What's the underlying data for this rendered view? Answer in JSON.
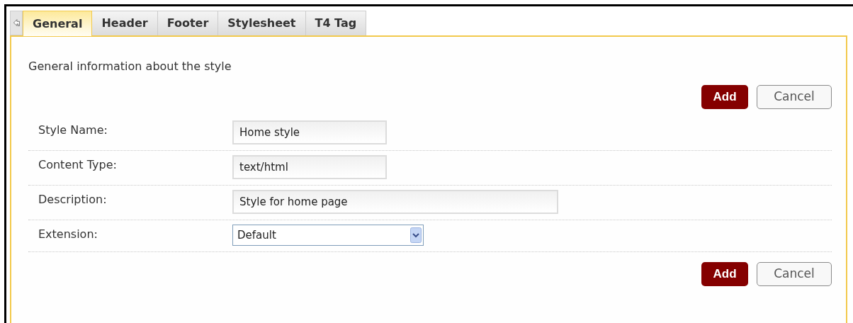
{
  "tabs": [
    {
      "label": "General",
      "selected": true
    },
    {
      "label": "Header",
      "selected": false
    },
    {
      "label": "Footer",
      "selected": false
    },
    {
      "label": "Stylesheet",
      "selected": false
    },
    {
      "label": "T4 Tag",
      "selected": false
    }
  ],
  "intro": "General information about the style",
  "top_buttons": {
    "add": "Add",
    "cancel": "Cancel"
  },
  "fields": [
    {
      "label": "Style Name:",
      "kind": "text",
      "value": "Home style"
    },
    {
      "label": "Content Type:",
      "kind": "text",
      "value": "text/html"
    },
    {
      "label": "Description:",
      "kind": "text",
      "value": "Style for home page"
    },
    {
      "label": "Extension:",
      "kind": "select",
      "value": "Default"
    }
  ],
  "bottom_buttons": {
    "add": "Add",
    "cancel": "Cancel"
  }
}
